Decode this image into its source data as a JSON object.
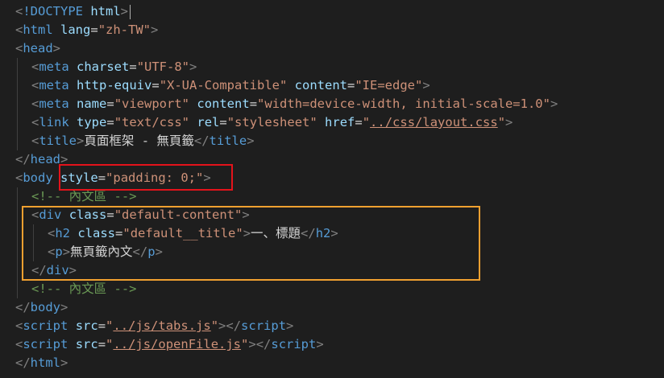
{
  "editor": {
    "lines": [
      {
        "indent": 0,
        "tokens": [
          [
            "bracket",
            "<"
          ],
          [
            "doctype",
            "!DOCTYPE"
          ],
          [
            "text",
            " "
          ],
          [
            "attr",
            "html"
          ],
          [
            "bracket",
            ">"
          ]
        ],
        "cursor": true
      },
      {
        "indent": 0,
        "tokens": [
          [
            "bracket",
            "<"
          ],
          [
            "tag",
            "html"
          ],
          [
            "text",
            " "
          ],
          [
            "attr",
            "lang"
          ],
          [
            "text",
            "="
          ],
          [
            "str",
            "\"zh-TW\""
          ],
          [
            "bracket",
            ">"
          ]
        ]
      },
      {
        "indent": 0,
        "tokens": [
          [
            "bracket",
            "<"
          ],
          [
            "tag",
            "head"
          ],
          [
            "bracket",
            ">"
          ]
        ]
      },
      {
        "indent": 1,
        "tokens": [
          [
            "bracket",
            "<"
          ],
          [
            "tag",
            "meta"
          ],
          [
            "text",
            " "
          ],
          [
            "attr",
            "charset"
          ],
          [
            "text",
            "="
          ],
          [
            "str",
            "\"UTF-8\""
          ],
          [
            "bracket",
            ">"
          ]
        ]
      },
      {
        "indent": 1,
        "tokens": [
          [
            "bracket",
            "<"
          ],
          [
            "tag",
            "meta"
          ],
          [
            "text",
            " "
          ],
          [
            "attr",
            "http-equiv"
          ],
          [
            "text",
            "="
          ],
          [
            "str",
            "\"X-UA-Compatible\""
          ],
          [
            "text",
            " "
          ],
          [
            "attr",
            "content"
          ],
          [
            "text",
            "="
          ],
          [
            "str",
            "\"IE=edge\""
          ],
          [
            "bracket",
            ">"
          ]
        ]
      },
      {
        "indent": 1,
        "tokens": [
          [
            "bracket",
            "<"
          ],
          [
            "tag",
            "meta"
          ],
          [
            "text",
            " "
          ],
          [
            "attr",
            "name"
          ],
          [
            "text",
            "="
          ],
          [
            "str",
            "\"viewport\""
          ],
          [
            "text",
            " "
          ],
          [
            "attr",
            "content"
          ],
          [
            "text",
            "="
          ],
          [
            "str",
            "\"width=device-width, initial-scale=1.0\""
          ],
          [
            "bracket",
            ">"
          ]
        ]
      },
      {
        "indent": 1,
        "tokens": [
          [
            "bracket",
            "<"
          ],
          [
            "tag",
            "link"
          ],
          [
            "text",
            " "
          ],
          [
            "attr",
            "type"
          ],
          [
            "text",
            "="
          ],
          [
            "str",
            "\"text/css\""
          ],
          [
            "text",
            " "
          ],
          [
            "attr",
            "rel"
          ],
          [
            "text",
            "="
          ],
          [
            "str",
            "\"stylesheet\""
          ],
          [
            "text",
            " "
          ],
          [
            "attr",
            "href"
          ],
          [
            "text",
            "="
          ],
          [
            "str",
            "\""
          ],
          [
            "strlink",
            "../css/layout.css"
          ],
          [
            "str",
            "\""
          ],
          [
            "bracket",
            ">"
          ]
        ]
      },
      {
        "indent": 1,
        "tokens": [
          [
            "bracket",
            "<"
          ],
          [
            "tag",
            "title"
          ],
          [
            "bracket",
            ">"
          ],
          [
            "text",
            "頁面框架 - 無頁籤"
          ],
          [
            "bracket",
            "</"
          ],
          [
            "tag",
            "title"
          ],
          [
            "bracket",
            ">"
          ]
        ]
      },
      {
        "indent": 0,
        "tokens": [
          [
            "bracket",
            "</"
          ],
          [
            "tag",
            "head"
          ],
          [
            "bracket",
            ">"
          ]
        ]
      },
      {
        "indent": 0,
        "tokens": [
          [
            "bracket",
            "<"
          ],
          [
            "tag",
            "body"
          ],
          [
            "text",
            " "
          ],
          [
            "attr",
            "style"
          ],
          [
            "text",
            "="
          ],
          [
            "str",
            "\"padding: 0;\""
          ],
          [
            "bracket",
            ">"
          ]
        ]
      },
      {
        "indent": 1,
        "tokens": [
          [
            "comment",
            "<!-- 內文區 -->"
          ]
        ]
      },
      {
        "indent": 1,
        "tokens": [
          [
            "bracket",
            "<"
          ],
          [
            "tag",
            "div"
          ],
          [
            "text",
            " "
          ],
          [
            "attr",
            "class"
          ],
          [
            "text",
            "="
          ],
          [
            "str",
            "\"default-content\""
          ],
          [
            "bracket",
            ">"
          ]
        ]
      },
      {
        "indent": 2,
        "tokens": [
          [
            "bracket",
            "<"
          ],
          [
            "tag",
            "h2"
          ],
          [
            "text",
            " "
          ],
          [
            "attr",
            "class"
          ],
          [
            "text",
            "="
          ],
          [
            "str",
            "\"default__title\""
          ],
          [
            "bracket",
            ">"
          ],
          [
            "text",
            "一、標題"
          ],
          [
            "bracket",
            "</"
          ],
          [
            "tag",
            "h2"
          ],
          [
            "bracket",
            ">"
          ]
        ]
      },
      {
        "indent": 2,
        "tokens": [
          [
            "bracket",
            "<"
          ],
          [
            "tag",
            "p"
          ],
          [
            "bracket",
            ">"
          ],
          [
            "text",
            "無頁籤內文"
          ],
          [
            "bracket",
            "</"
          ],
          [
            "tag",
            "p"
          ],
          [
            "bracket",
            ">"
          ]
        ]
      },
      {
        "indent": 1,
        "tokens": [
          [
            "bracket",
            "</"
          ],
          [
            "tag",
            "div"
          ],
          [
            "bracket",
            ">"
          ]
        ]
      },
      {
        "indent": 1,
        "tokens": [
          [
            "comment",
            "<!-- 內文區 -->"
          ]
        ]
      },
      {
        "indent": 0,
        "tokens": [
          [
            "bracket",
            "</"
          ],
          [
            "tag",
            "body"
          ],
          [
            "bracket",
            ">"
          ]
        ]
      },
      {
        "indent": 0,
        "tokens": [
          [
            "bracket",
            "<"
          ],
          [
            "tag",
            "script"
          ],
          [
            "text",
            " "
          ],
          [
            "attr",
            "src"
          ],
          [
            "text",
            "="
          ],
          [
            "str",
            "\""
          ],
          [
            "strlink",
            "../js/tabs.js"
          ],
          [
            "str",
            "\""
          ],
          [
            "bracket",
            "></"
          ],
          [
            "tag",
            "script"
          ],
          [
            "bracket",
            ">"
          ]
        ]
      },
      {
        "indent": 0,
        "tokens": [
          [
            "bracket",
            "<"
          ],
          [
            "tag",
            "script"
          ],
          [
            "text",
            " "
          ],
          [
            "attr",
            "src"
          ],
          [
            "text",
            "="
          ],
          [
            "str",
            "\""
          ],
          [
            "strlink",
            "../js/openFile.js"
          ],
          [
            "str",
            "\""
          ],
          [
            "bracket",
            "></"
          ],
          [
            "tag",
            "script"
          ],
          [
            "bracket",
            ">"
          ]
        ]
      },
      {
        "indent": 0,
        "tokens": [
          [
            "bracket",
            "</"
          ],
          [
            "tag",
            "html"
          ],
          [
            "bracket",
            ">"
          ]
        ]
      }
    ]
  },
  "colors": {
    "background": "#1e1e1e",
    "highlight_red": "#e4131b",
    "highlight_orange": "#f0a030"
  }
}
